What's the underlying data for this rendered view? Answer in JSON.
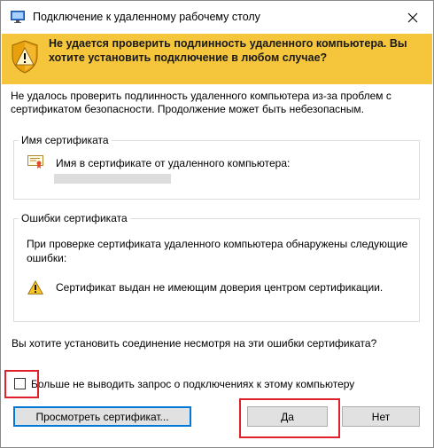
{
  "window": {
    "title": "Подключение к удаленному рабочему столу",
    "close_symbol": "✕"
  },
  "banner": {
    "text": "Не удается проверить подлинность удаленного компьютера. Вы хотите установить подключение в любом случае?",
    "color": "#f5c53b"
  },
  "intro_text": "Не удалось проверить подлинность удаленного компьютера из-за проблем с сертификатом безопасности. Продолжение может быть небезопасным.",
  "cert_group": {
    "legend": "Имя сертификата",
    "name_label": "Имя в сертификате от удаленного компьютера:",
    "icon": "certificate-icon"
  },
  "errors_group": {
    "legend": "Ошибки сертификата",
    "intro": "При проверке сертификата удаленного компьютера обнаружены следующие ошибки:",
    "error_text": "Сертификат выдан не имеющим доверия центром сертификации.",
    "icon": "warning-icon"
  },
  "question": "Вы хотите установить соединение несмотря на эти ошибки сертификата?",
  "checkbox": {
    "label": "Больше не выводить запрос о подключениях к этому компьютеру",
    "checked": false
  },
  "buttons": {
    "view": "Просмотреть сертификат...",
    "yes": "Да",
    "no": "Нет"
  },
  "highlight_color": "#e0202a"
}
